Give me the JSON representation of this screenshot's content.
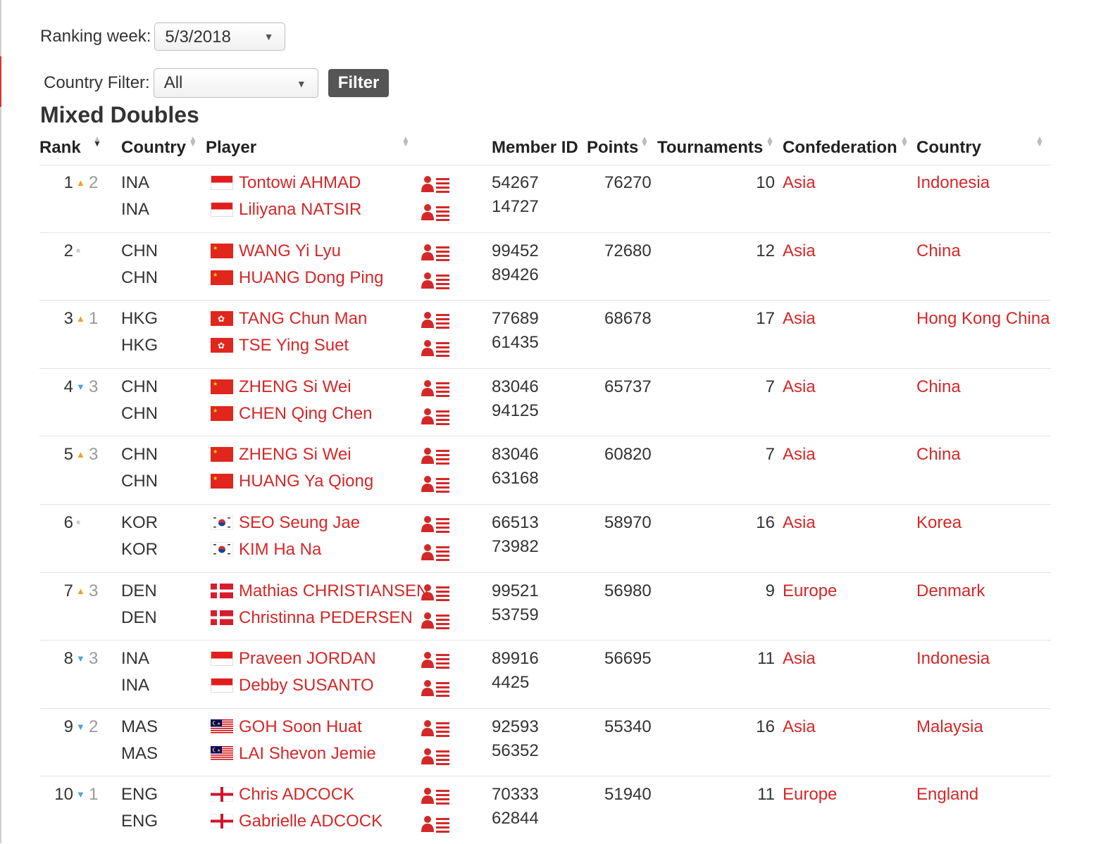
{
  "filters": {
    "ranking_week_label": "Ranking week:",
    "ranking_week_value": "5/3/2018",
    "country_filter_label": "Country Filter:",
    "country_filter_value": "All",
    "filter_button": "Filter"
  },
  "title": "Mixed Doubles",
  "headers": {
    "rank": "Rank",
    "country": "Country",
    "player": "Player",
    "member_id": "Member ID",
    "points": "Points",
    "tournaments": "Tournaments",
    "confederation": "Confederation",
    "country_name": "Country"
  },
  "rows": [
    {
      "rank": "1",
      "trend": "up",
      "change": "2",
      "codes": [
        "INA",
        "INA"
      ],
      "flag": "indonesia",
      "players": [
        "Tontowi AHMAD",
        "Liliyana NATSIR"
      ],
      "ids": [
        "54267",
        "14727"
      ],
      "points": "76270",
      "tournaments": "10",
      "confederation": "Asia",
      "country": "Indonesia"
    },
    {
      "rank": "2",
      "trend": "same",
      "change": "",
      "codes": [
        "CHN",
        "CHN"
      ],
      "flag": "china",
      "players": [
        "WANG Yi Lyu",
        "HUANG Dong Ping"
      ],
      "ids": [
        "99452",
        "89426"
      ],
      "points": "72680",
      "tournaments": "12",
      "confederation": "Asia",
      "country": "China"
    },
    {
      "rank": "3",
      "trend": "up",
      "change": "1",
      "codes": [
        "HKG",
        "HKG"
      ],
      "flag": "hongkong",
      "players": [
        "TANG Chun Man",
        "TSE Ying Suet"
      ],
      "ids": [
        "77689",
        "61435"
      ],
      "points": "68678",
      "tournaments": "17",
      "confederation": "Asia",
      "country": "Hong Kong China"
    },
    {
      "rank": "4",
      "trend": "down",
      "change": "3",
      "codes": [
        "CHN",
        "CHN"
      ],
      "flag": "china",
      "players": [
        "ZHENG Si Wei",
        "CHEN Qing Chen"
      ],
      "ids": [
        "83046",
        "94125"
      ],
      "points": "65737",
      "tournaments": "7",
      "confederation": "Asia",
      "country": "China"
    },
    {
      "rank": "5",
      "trend": "up",
      "change": "3",
      "codes": [
        "CHN",
        "CHN"
      ],
      "flag": "china",
      "players": [
        "ZHENG Si Wei",
        "HUANG Ya Qiong"
      ],
      "ids": [
        "83046",
        "63168"
      ],
      "points": "60820",
      "tournaments": "7",
      "confederation": "Asia",
      "country": "China"
    },
    {
      "rank": "6",
      "trend": "same",
      "change": "",
      "codes": [
        "KOR",
        "KOR"
      ],
      "flag": "korea",
      "players": [
        "SEO Seung Jae",
        "KIM Ha Na"
      ],
      "ids": [
        "66513",
        "73982"
      ],
      "points": "58970",
      "tournaments": "16",
      "confederation": "Asia",
      "country": "Korea"
    },
    {
      "rank": "7",
      "trend": "up",
      "change": "3",
      "codes": [
        "DEN",
        "DEN"
      ],
      "flag": "denmark",
      "players": [
        "Mathias CHRISTIANSEN",
        "Christinna PEDERSEN"
      ],
      "ids": [
        "99521",
        "53759"
      ],
      "points": "56980",
      "tournaments": "9",
      "confederation": "Europe",
      "country": "Denmark"
    },
    {
      "rank": "8",
      "trend": "down",
      "change": "3",
      "codes": [
        "INA",
        "INA"
      ],
      "flag": "indonesia",
      "players": [
        "Praveen JORDAN",
        "Debby SUSANTO"
      ],
      "ids": [
        "89916",
        "4425"
      ],
      "points": "56695",
      "tournaments": "11",
      "confederation": "Asia",
      "country": "Indonesia"
    },
    {
      "rank": "9",
      "trend": "down",
      "change": "2",
      "codes": [
        "MAS",
        "MAS"
      ],
      "flag": "malaysia",
      "players": [
        "GOH Soon Huat",
        "LAI Shevon Jemie"
      ],
      "ids": [
        "92593",
        "56352"
      ],
      "points": "55340",
      "tournaments": "16",
      "confederation": "Asia",
      "country": "Malaysia"
    },
    {
      "rank": "10",
      "trend": "down",
      "change": "1",
      "codes": [
        "ENG",
        "ENG"
      ],
      "flag": "england",
      "players": [
        "Chris ADCOCK",
        "Gabrielle ADCOCK"
      ],
      "ids": [
        "70333",
        "62844"
      ],
      "points": "51940",
      "tournaments": "11",
      "confederation": "Europe",
      "country": "England"
    }
  ],
  "colors": {
    "link": "#d42828",
    "up": "#f0a020",
    "down": "#4aa3e0",
    "button": "#555555"
  }
}
